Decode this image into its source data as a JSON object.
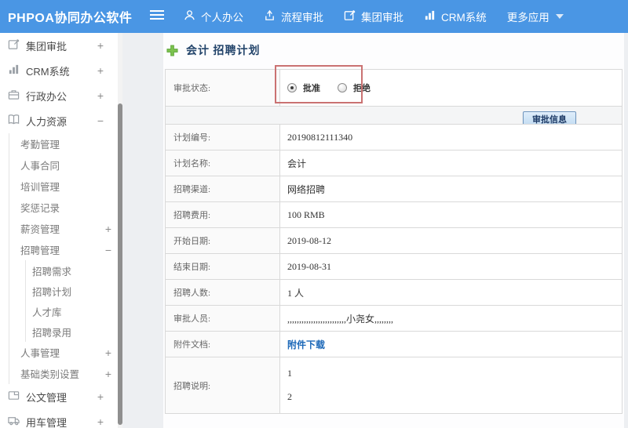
{
  "topbar": {
    "logo": "PHPOA协同办公软件",
    "items": [
      {
        "label": "个人办公",
        "icon": "person-icon"
      },
      {
        "label": "流程审批",
        "icon": "flow-icon"
      },
      {
        "label": "集团审批",
        "icon": "edit-icon"
      },
      {
        "label": "CRM系统",
        "icon": "chart-icon"
      },
      {
        "label": "更多应用",
        "icon": "caret-down-icon"
      }
    ]
  },
  "sidebar": {
    "items": [
      {
        "label": "集团审批",
        "expand": "+"
      },
      {
        "label": "CRM系统",
        "expand": "+"
      },
      {
        "label": "行政办公",
        "expand": "+"
      },
      {
        "label": "人力资源",
        "expand": "−",
        "children": [
          {
            "label": "考勤管理"
          },
          {
            "label": "人事合同"
          },
          {
            "label": "培训管理"
          },
          {
            "label": "奖惩记录"
          },
          {
            "label": "薪资管理",
            "expand": "+"
          },
          {
            "label": "招聘管理",
            "expand": "−",
            "children": [
              {
                "label": "招聘需求"
              },
              {
                "label": "招聘计划"
              },
              {
                "label": "人才库"
              },
              {
                "label": "招聘录用"
              }
            ]
          },
          {
            "label": "人事管理",
            "expand": "+"
          },
          {
            "label": "基础类别设置",
            "expand": "+"
          }
        ]
      },
      {
        "label": "公文管理",
        "expand": "+"
      },
      {
        "label": "用车管理",
        "expand": "+"
      }
    ]
  },
  "main": {
    "title": "会计 招聘计划",
    "approval": {
      "label": "审批状态:",
      "options": [
        {
          "label": "批准",
          "selected": true
        },
        {
          "label": "拒绝",
          "selected": false
        }
      ],
      "button": "审批信息"
    },
    "fields": [
      {
        "label": "计划编号:",
        "value": "20190812111340"
      },
      {
        "label": "计划名称:",
        "value": "会计"
      },
      {
        "label": "招聘渠道:",
        "value": "网络招聘"
      },
      {
        "label": "招聘费用:",
        "value": "100 RMB"
      },
      {
        "label": "开始日期:",
        "value": "2019-08-12"
      },
      {
        "label": "结束日期:",
        "value": "2019-08-31"
      },
      {
        "label": "招聘人数:",
        "value": "1 人"
      },
      {
        "label": "审批人员:",
        "value": ",,,,,,,,,,,,,,,,,,,,,,,,,小尧女,,,,,,,,"
      },
      {
        "label": "附件文档:",
        "value": "附件下载"
      },
      {
        "label": "招聘说明:",
        "value": "1\n\n2"
      }
    ]
  },
  "colors": {
    "topbar_blue": "#4a96e4",
    "highlight_red": "#ca7272",
    "link_blue": "#1c68b8",
    "title_navy": "#24456b"
  }
}
